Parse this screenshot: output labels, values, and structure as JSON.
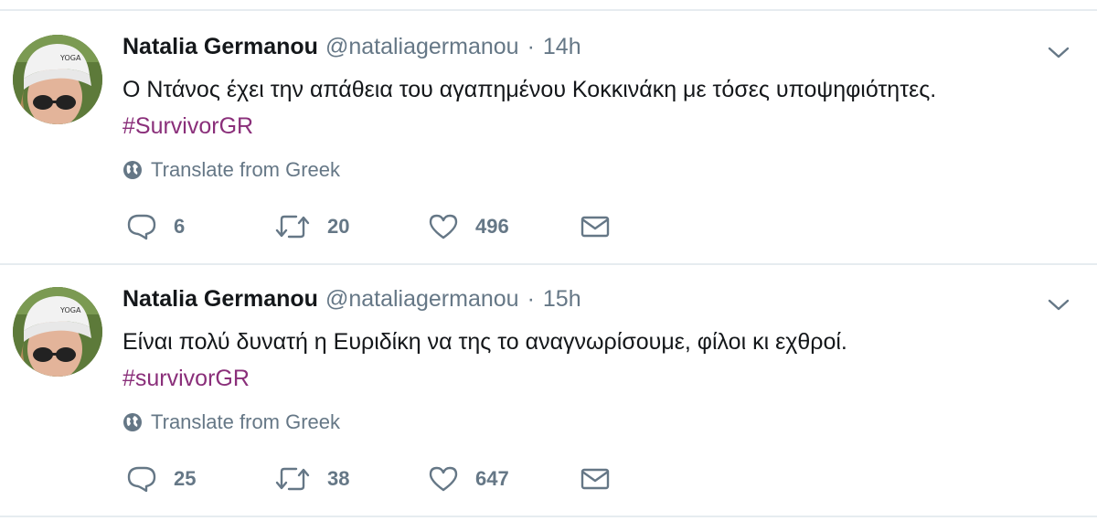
{
  "tweets": [
    {
      "author_name": "Natalia Germanou",
      "handle": "@nataliagermanou",
      "separator": "·",
      "time": "14h",
      "text": "Ο Ντάνος έχει την απάθεια του αγαπημένου Κοκκινάκη με τόσες υποψηφιότητες.",
      "hashtag": "#SurvivorGR",
      "translate_label": "Translate from Greek",
      "replies": "6",
      "retweets": "20",
      "likes": "496"
    },
    {
      "author_name": "Natalia Germanou",
      "handle": "@nataliagermanou",
      "separator": "·",
      "time": "15h",
      "text": "Είναι πολύ δυνατή η Ευριδίκη να της το αναγνωρίσουμε, φίλοι κι εχθροί.",
      "hashtag": "#survivorGR",
      "translate_label": "Translate from Greek",
      "replies": "25",
      "retweets": "38",
      "likes": "647"
    }
  ],
  "icons": {
    "reply": "reply-icon",
    "retweet": "retweet-icon",
    "like": "heart-icon",
    "direct_message": "envelope-icon",
    "translate": "globe-icon",
    "menu": "chevron-down-icon"
  },
  "colors": {
    "text": "#14171a",
    "muted": "#657786",
    "hashtag": "#8a2f7a",
    "divider": "#e6ecf0"
  }
}
